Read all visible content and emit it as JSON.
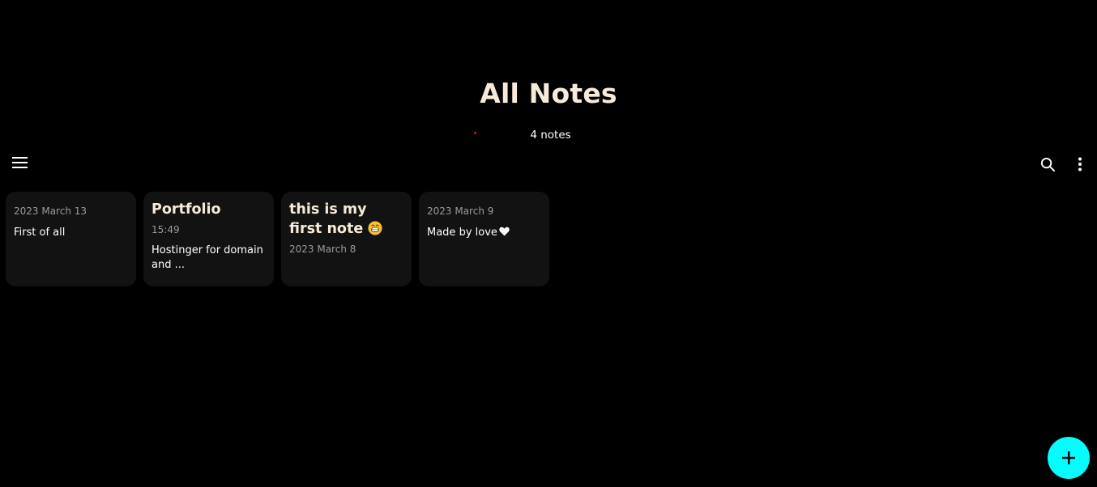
{
  "header": {
    "title": "All Notes",
    "count_label": "4 notes"
  },
  "toolbar": {
    "menu_icon": "hamburger-menu-icon",
    "search_icon": "search-icon",
    "more_icon": "more-vertical-icon"
  },
  "notes": [
    {
      "title": "",
      "date": "2023 March 13",
      "body": "First of all"
    },
    {
      "title": "Portfolio",
      "date": "15:49",
      "body": "Hostinger for domain and ..."
    },
    {
      "title": "this is my first note",
      "title_emoji": "grinning-face-emoji",
      "date": "2023 March 8",
      "body": ""
    },
    {
      "title": "",
      "date": "2023 March 9",
      "body": "Made by love",
      "body_emoji": "white-heart-emoji"
    }
  ],
  "fab": {
    "label": "+",
    "icon": "plus-icon"
  },
  "colors": {
    "background": "#000000",
    "card_background": "#121212",
    "title_color": "#f8ead8",
    "date_color": "#9a9a9a",
    "fab_color": "#00ffff",
    "dot_color": "#d11a1a"
  }
}
